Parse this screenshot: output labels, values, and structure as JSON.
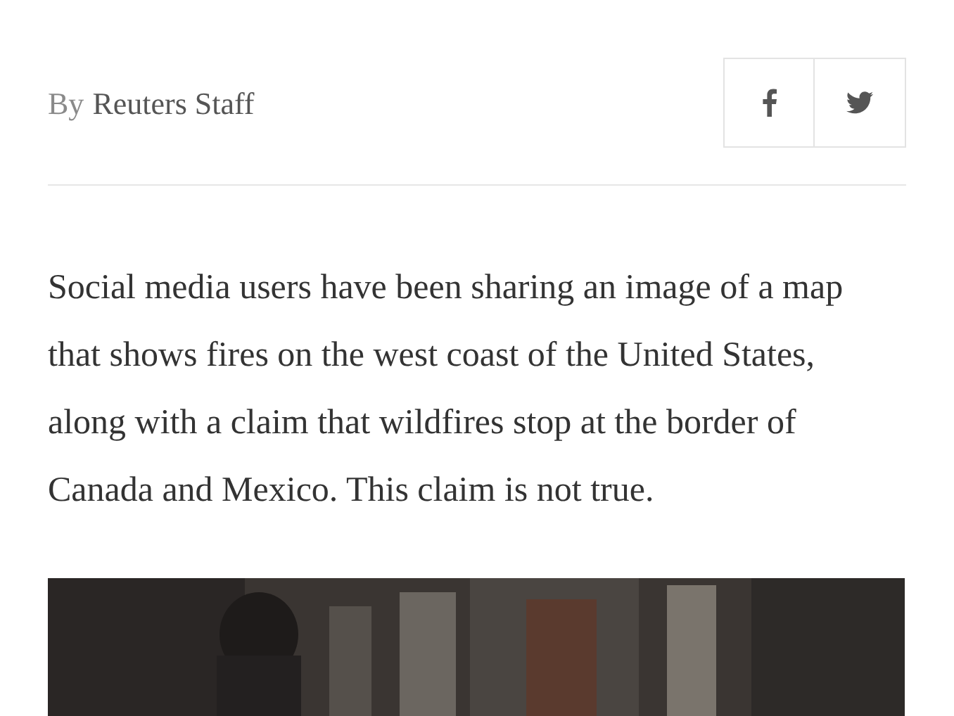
{
  "byline": {
    "prefix": "By",
    "author": "Reuters Staff"
  },
  "share_buttons": [
    {
      "kind": "facebook"
    },
    {
      "kind": "twitter"
    }
  ],
  "body": "Social media users have been sharing an image of a map that shows fires on the west coast of the United States, along with a claim that wildfires stop at the border of Canada and Mexico. This claim is not true."
}
